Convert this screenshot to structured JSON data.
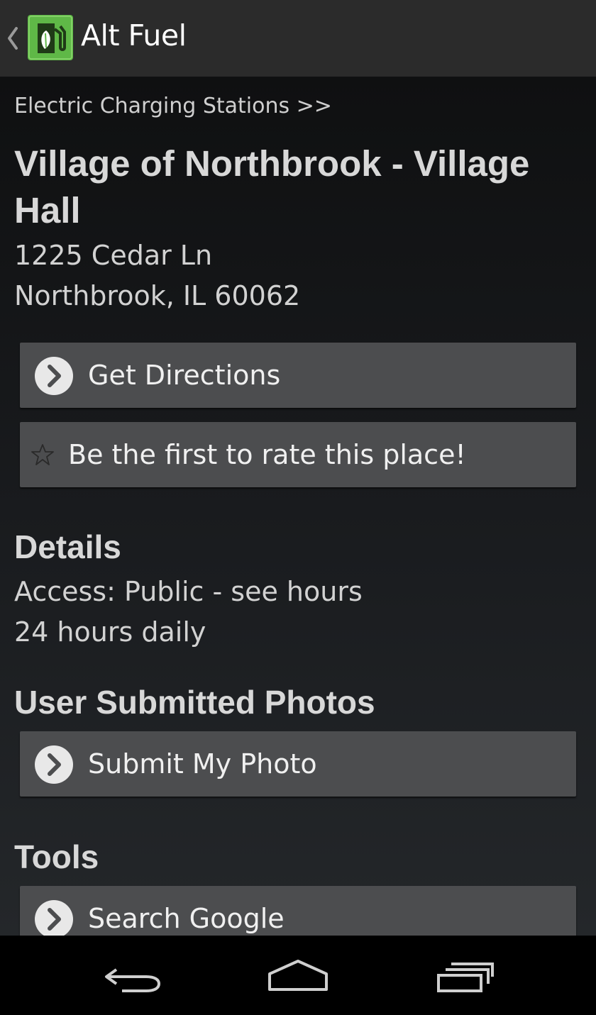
{
  "action_bar": {
    "title": "Alt Fuel",
    "icons": {
      "up": "chevron-left-icon",
      "app": "fuel-pump-leaf-icon"
    },
    "colors": {
      "app_icon_bg": "#5fb847"
    }
  },
  "station": {
    "category_link": "Electric Charging Stations >>",
    "name": "Village of Northbrook - Village Hall",
    "address_line1": "1225 Cedar Ln",
    "address_line2": "Northbrook, IL 60062"
  },
  "actions": {
    "directions_label": "Get Directions",
    "rate_label": "Be the first to rate this place!"
  },
  "details": {
    "heading": "Details",
    "access": "Access: Public - see hours",
    "hours": "24 hours daily"
  },
  "photos": {
    "heading": "User Submitted Photos",
    "submit_label": "Submit My Photo"
  },
  "tools": {
    "heading": "Tools",
    "search_label": "Search Google"
  },
  "nav_bar": {
    "icons": [
      "back-icon",
      "home-icon",
      "recents-icon"
    ]
  }
}
